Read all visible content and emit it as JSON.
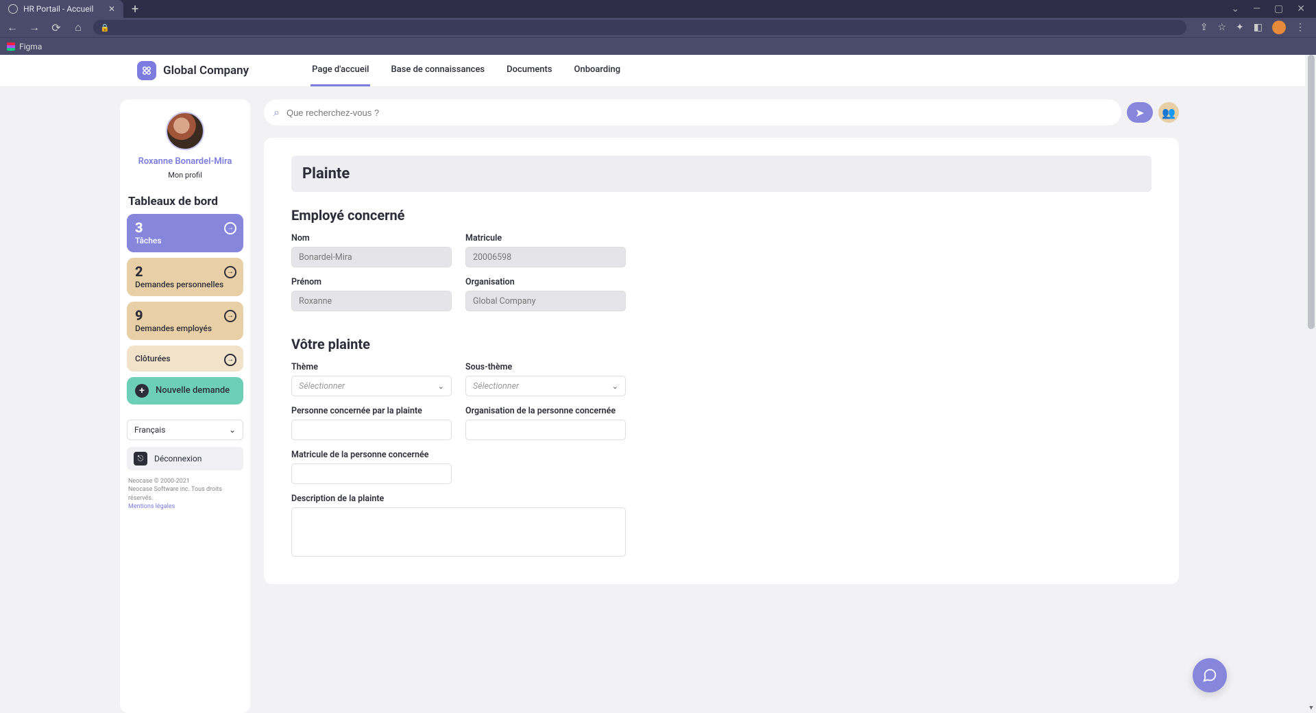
{
  "browser": {
    "tab_title": "HR Portail - Accueil",
    "bookmark_figma": "Figma"
  },
  "header": {
    "company": "Global Company",
    "nav": {
      "home": "Page d'accueil",
      "kb": "Base de connaissances",
      "docs": "Documents",
      "onboarding": "Onboarding"
    }
  },
  "sidebar": {
    "user_name": "Roxanne Bonardel-Mira",
    "profile_link": "Mon profil",
    "dashboards_title": "Tableaux de bord",
    "cards": {
      "tasks": {
        "count": "3",
        "label": "Tâches"
      },
      "personal": {
        "count": "2",
        "label": "Demandes personnelles"
      },
      "employees": {
        "count": "9",
        "label": "Demandes employés"
      },
      "closed": {
        "label": "Clôturées"
      }
    },
    "new_request": "Nouvelle demande",
    "language": "Français",
    "logout": "Déconnexion",
    "legal1": "Neocase © 2000-2021",
    "legal2": "Neocase Software inc. Tous droits réservés.",
    "legal_link": "Mentions légales"
  },
  "search": {
    "placeholder": "Que recherchez-vous ?"
  },
  "form": {
    "title": "Plainte",
    "section_employee": "Employé concerné",
    "section_complaint": "Vôtre plainte",
    "labels": {
      "nom": "Nom",
      "prenom": "Prénom",
      "matricule": "Matricule",
      "organisation": "Organisation",
      "theme": "Thème",
      "soustheme": "Sous-thème",
      "personne": "Personne concernée par la plainte",
      "org_personne": "Organisation de la personne concernée",
      "matricule_personne": "Matricule de la personne concernée",
      "description": "Description de la plainte"
    },
    "values": {
      "nom": "Bonardel-Mira",
      "prenom": "Roxanne",
      "matricule": "20006598",
      "organisation": "Global Company"
    },
    "select_placeholder": "Sélectionner"
  }
}
